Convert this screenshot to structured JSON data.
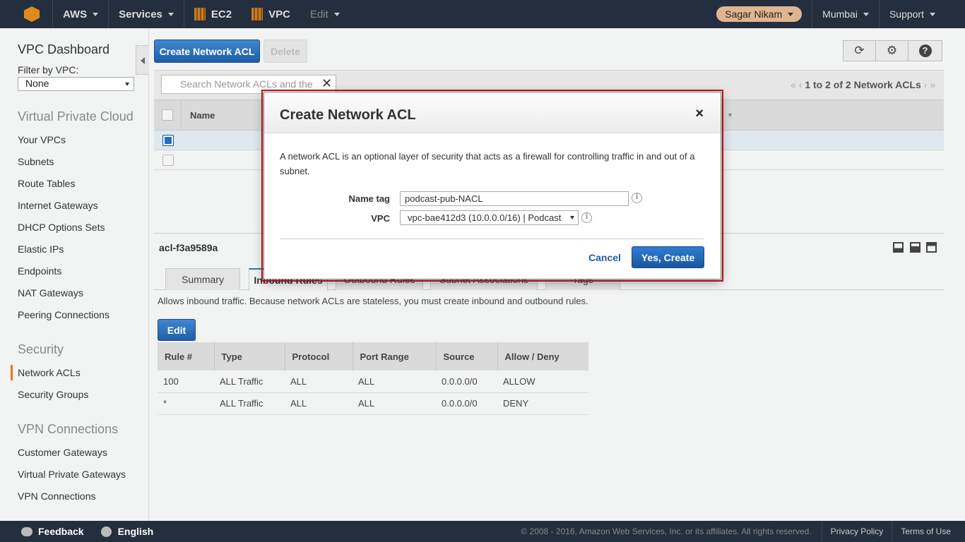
{
  "nav": {
    "aws": "AWS",
    "services": "Services",
    "ec2": "EC2",
    "vpc": "VPC",
    "edit": "Edit",
    "user": "Sagar Nikam",
    "region": "Mumbai",
    "support": "Support"
  },
  "sidebar": {
    "dashboard": "VPC Dashboard",
    "filter_label": "Filter by VPC:",
    "filter_value": "None",
    "section_vpc": "Virtual Private Cloud",
    "vpc_items": [
      "Your VPCs",
      "Subnets",
      "Route Tables",
      "Internet Gateways",
      "DHCP Options Sets",
      "Elastic IPs",
      "Endpoints",
      "NAT Gateways",
      "Peering Connections"
    ],
    "section_security": "Security",
    "security_items": [
      "Network ACLs",
      "Security Groups"
    ],
    "section_vpn": "VPN Connections",
    "vpn_items": [
      "Customer Gateways",
      "Virtual Private Gateways",
      "VPN Connections"
    ]
  },
  "toolbar": {
    "create_label": "Create Network ACL",
    "delete_label": "Delete",
    "search_placeholder": "Search Network ACLs and the",
    "pager": "1 to 2 of 2 Network ACLs"
  },
  "list": {
    "name_header": "Name"
  },
  "detail": {
    "acl_id": "acl-f3a9589a",
    "tabs": [
      "Summary",
      "Inbound Rules",
      "Outbound Rules",
      "Subnet Associations",
      "Tags"
    ],
    "description": "Allows inbound traffic. Because network ACLs are stateless, you must create inbound and outbound rules.",
    "edit_label": "Edit",
    "rule_headers": [
      "Rule #",
      "Type",
      "Protocol",
      "Port Range",
      "Source",
      "Allow / Deny"
    ],
    "rules": [
      [
        "100",
        "ALL Traffic",
        "ALL",
        "ALL",
        "0.0.0.0/0",
        "ALLOW"
      ],
      [
        "*",
        "ALL Traffic",
        "ALL",
        "ALL",
        "0.0.0.0/0",
        "DENY"
      ]
    ]
  },
  "modal": {
    "title": "Create Network ACL",
    "close": "×",
    "description": "A network ACL is an optional layer of security that acts as a firewall for controlling traffic in and out of a subnet.",
    "name_label": "Name tag",
    "name_value": "podcast-pub-NACL",
    "vpc_label": "VPC",
    "vpc_value": "vpc-bae412d3 (10.0.0.0/16) | Podcast",
    "cancel_label": "Cancel",
    "create_label": "Yes, Create"
  },
  "footer": {
    "feedback": "Feedback",
    "language": "English",
    "copyright": "© 2008 - 2016, Amazon Web Services, Inc. or its affiliates. All rights reserved.",
    "privacy": "Privacy Policy",
    "terms": "Terms of Use"
  },
  "colors": {
    "nav_bg": "#232f3e",
    "primary_button": "#1e5fa8",
    "allow": "#1d8102",
    "deny": "#d13212",
    "active_accent": "#e47911",
    "highlight_frame": "#d0121b"
  }
}
